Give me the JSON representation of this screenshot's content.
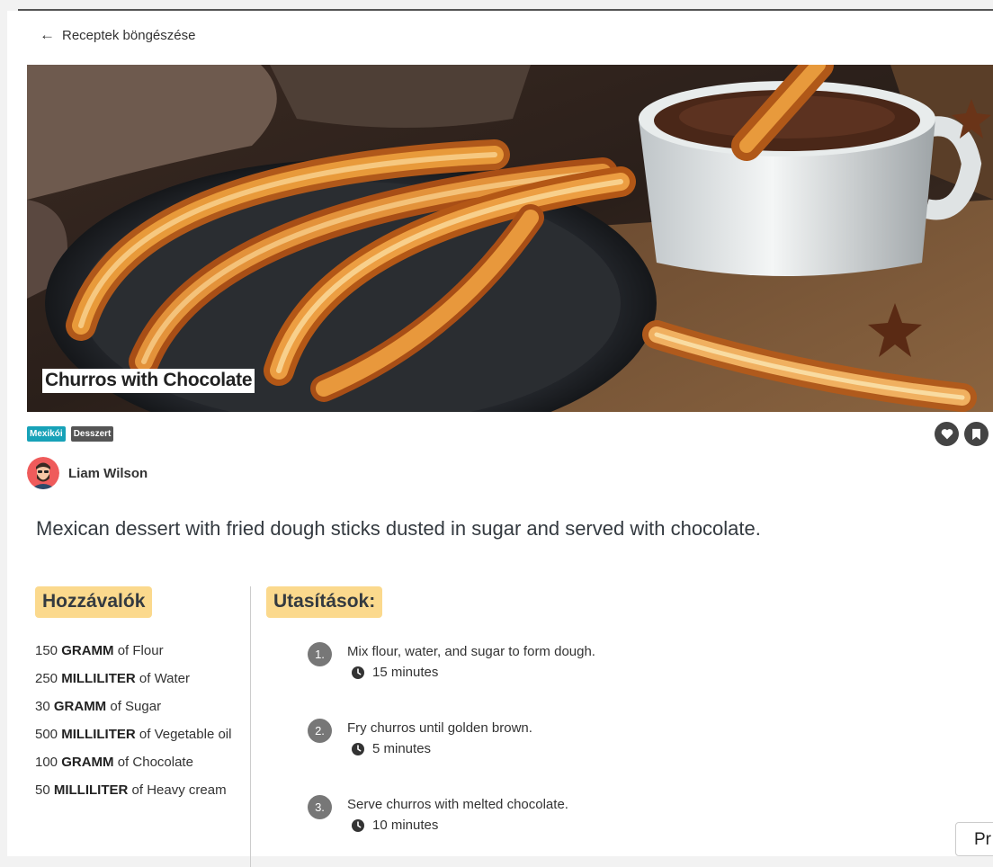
{
  "nav": {
    "back_label": "Receptek böngészése"
  },
  "recipe": {
    "title": "Churros with Chocolate",
    "tags": [
      "Mexikói",
      "Desszert"
    ],
    "author": "Liam Wilson",
    "description": "Mexican dessert with fried dough sticks dusted in sugar and served with chocolate."
  },
  "ingredients": {
    "heading": "Hozzávalók",
    "items": [
      {
        "amount": "150",
        "unit": "GRAMM",
        "of": "of",
        "name": "Flour"
      },
      {
        "amount": "250",
        "unit": "MILLILITER",
        "of": "of",
        "name": "Water"
      },
      {
        "amount": "30",
        "unit": "GRAMM",
        "of": "of",
        "name": "Sugar"
      },
      {
        "amount": "500",
        "unit": "MILLILITER",
        "of": "of",
        "name": "Vegetable oil"
      },
      {
        "amount": "100",
        "unit": "GRAMM",
        "of": "of",
        "name": "Chocolate"
      },
      {
        "amount": "50",
        "unit": "MILLILITER",
        "of": "of",
        "name": "Heavy cream"
      }
    ]
  },
  "instructions": {
    "heading": "Utasítások:",
    "steps": [
      {
        "num": "1.",
        "text": "Mix flour, water, and sugar to form dough.",
        "time": "15 minutes"
      },
      {
        "num": "2.",
        "text": "Fry churros until golden brown.",
        "time": "5 minutes"
      },
      {
        "num": "3.",
        "text": "Serve churros with melted chocolate.",
        "time": "10 minutes"
      }
    ]
  },
  "floating_button": {
    "label": "Pr"
  },
  "colors": {
    "tag_cuisine": "#17a2b8",
    "tag_category": "#555555",
    "section_highlight": "#fbd98d"
  },
  "icons": {
    "back": "arrow-left-icon",
    "favorite": "heart-icon",
    "save": "bookmark-icon",
    "time": "clock-icon"
  }
}
